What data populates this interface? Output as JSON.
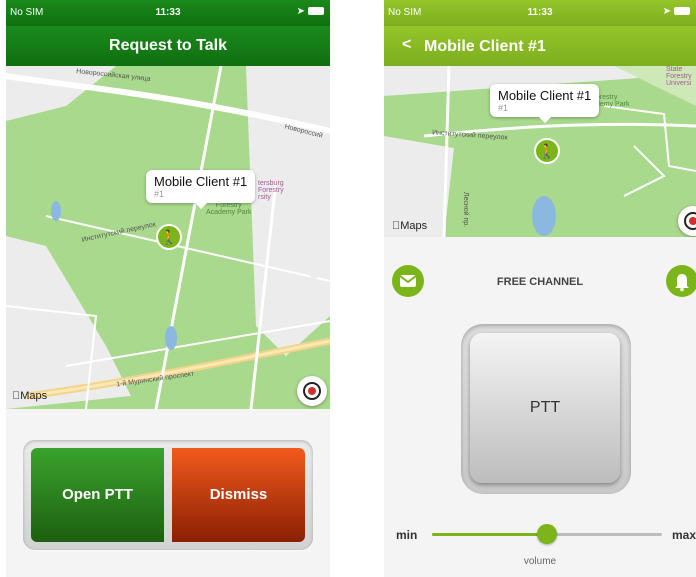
{
  "left_screen": {
    "status": {
      "carrier": "No SIM",
      "time": "11:33"
    },
    "title": "Request to Talk",
    "map": {
      "street_top": "Новороссийская улица",
      "street_right": "Новороссий",
      "street_bottom": "1-й Муринский проспект",
      "lane": "Институтский переулок",
      "park": "Forestry\nAcademy Park",
      "univ": "tersburg\nForestry\nrsity",
      "callout_name": "Mobile Client #1",
      "callout_sub": "#1",
      "maps_logo": "Maps"
    },
    "buttons": {
      "open": "Open PTT",
      "dismiss": "Dismiss"
    }
  },
  "right_screen": {
    "status": {
      "carrier": "No SIM",
      "time": "11:33"
    },
    "back_glyph": "<",
    "title": "Mobile Client #1",
    "map": {
      "lane": "Институтский переулок",
      "park": "orestry\ndemy Park",
      "univ": "State\nForestry\nUniversi",
      "callout_name": "Mobile Client #1",
      "callout_sub": "#1",
      "maps_logo": "Maps",
      "side_street": "Лесной пр."
    },
    "channel_label": "FREE CHANNEL",
    "ptt_label": "PTT",
    "slider": {
      "min": "min",
      "max": "max",
      "label": "volume",
      "value_fraction": 0.5
    }
  },
  "icons": {
    "pin": "walking-person-icon",
    "mail": "envelope-icon",
    "bell": "bell-icon",
    "locate": "location-target-icon"
  },
  "colors": {
    "left_nav": "#1b8a1b",
    "right_nav": "#8bbd26",
    "accent": "#7cb51a",
    "open_button": "#2e8b24",
    "dismiss_button": "#e2471a"
  }
}
